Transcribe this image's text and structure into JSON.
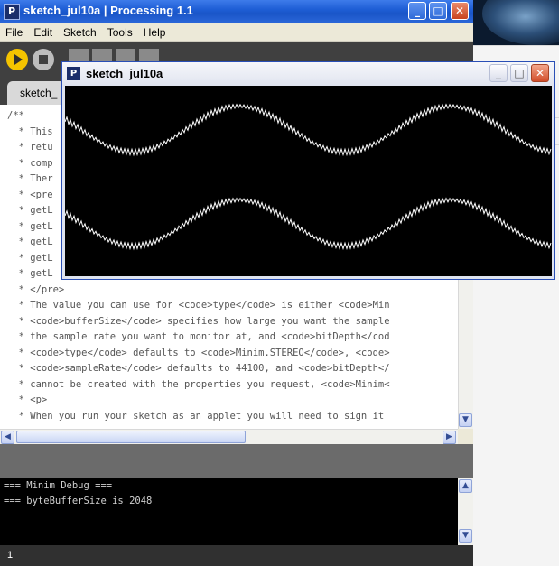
{
  "window": {
    "title": "sketch_jul10a | Processing 1.1",
    "app_icon": "P"
  },
  "menu": [
    "File",
    "Edit",
    "Sketch",
    "Tools",
    "Help"
  ],
  "tab": {
    "label": "sketch_"
  },
  "editor": {
    "lines": [
      "/**",
      "  * This",
      "  * retu",
      "  * comp",
      "  * Ther",
      "  * <pre",
      "  * getL",
      "  * getL",
      "  * getL",
      "  * getL",
      "  * getL",
      "  * </pre>",
      "  * The value you can use for <code>type</code> is either <code>Min",
      "  * <code>bufferSize</code> specifies how large you want the sample",
      "  * the sample rate you want to monitor at, and <code>bitDepth</cod",
      "  * <code>type</code> defaults to <code>Minim.STEREO</code>, <code>",
      "  * <code>sampleRate</code> defaults to 44100, and <code>bitDepth</",
      "  * cannot be created with the properties you request, <code>Minim<",
      "  * <p>",
      "  * When you run your sketch as an applet you will need to sign it"
    ]
  },
  "console": {
    "lines": [
      "=== Minim Debug ===",
      "=== byteBufferSize is 2048"
    ]
  },
  "status": {
    "line_number": "1"
  },
  "sketch_window": {
    "title": "sketch_jul10a",
    "app_icon": "P"
  },
  "colors": {
    "toolbar": "#404040",
    "run_button": "#f5c400",
    "waveform": "#ffffff",
    "canvas": "#000000"
  },
  "icons": {
    "run": "play-icon",
    "stop": "stop-icon",
    "minimize": "minimize-icon",
    "maximize": "maximize-icon",
    "close": "close-icon"
  }
}
